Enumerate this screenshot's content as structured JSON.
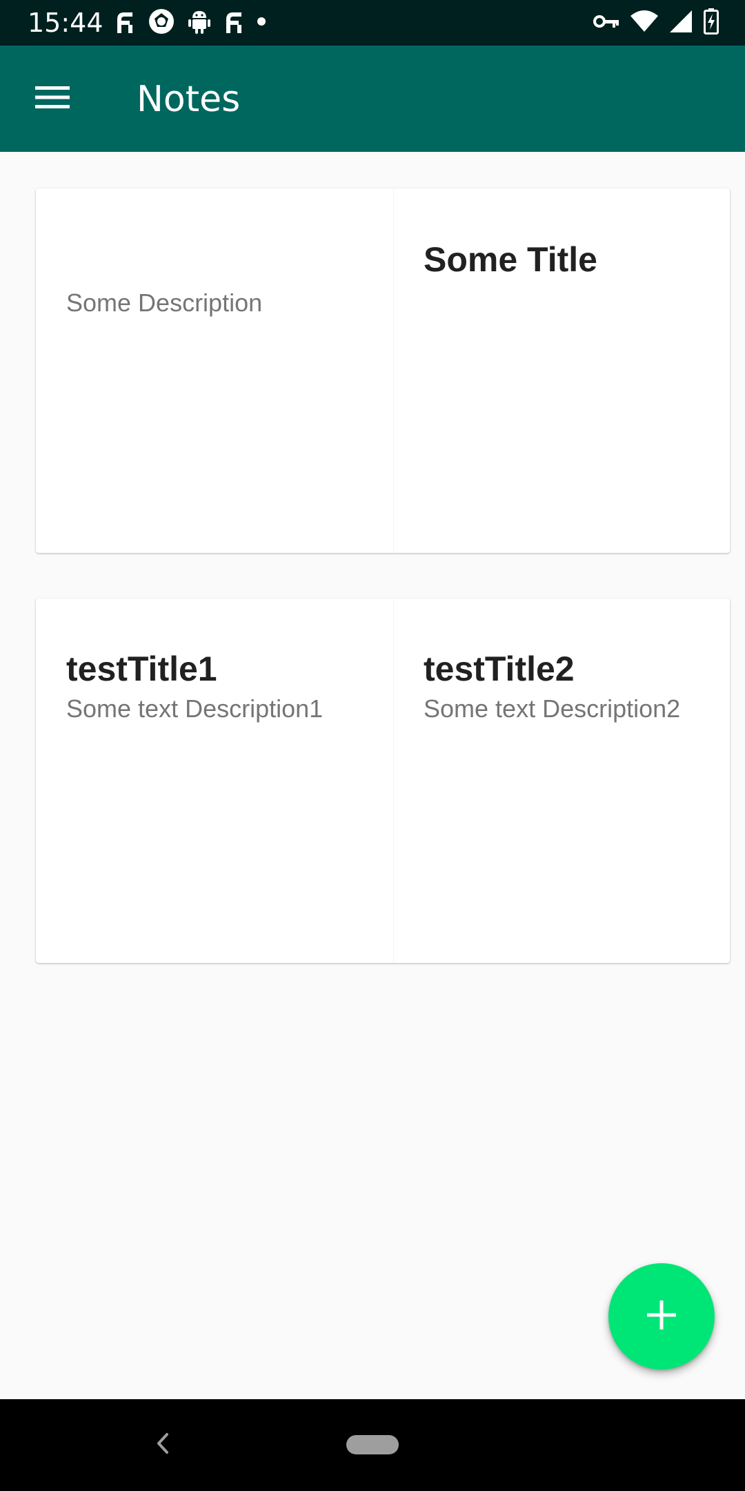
{
  "status_bar": {
    "time": "15:44",
    "notification_icons": [
      "fi-icon",
      "camera-shutter-icon",
      "android-icon",
      "fi-icon",
      "dot-icon"
    ],
    "system_icons": [
      "vpn-key-icon",
      "wifi-icon",
      "signal-icon",
      "battery-charging-icon"
    ]
  },
  "app_bar": {
    "menu_icon": "hamburger-menu-icon",
    "title": "Notes",
    "color": "#00675f"
  },
  "cards": [
    {
      "notes": [
        {
          "title": "",
          "description": "Some Description"
        },
        {
          "title": "Some Title",
          "description": ""
        }
      ]
    },
    {
      "notes": [
        {
          "title": "testTitle1",
          "description": "Some text Description1"
        },
        {
          "title": "testTitle2",
          "description": "Some text Description2"
        }
      ]
    }
  ],
  "fab": {
    "icon": "plus-icon",
    "color": "#00e676"
  },
  "nav_bar": {
    "back_icon": "back-chevron-icon",
    "home_icon": "home-pill-icon"
  }
}
